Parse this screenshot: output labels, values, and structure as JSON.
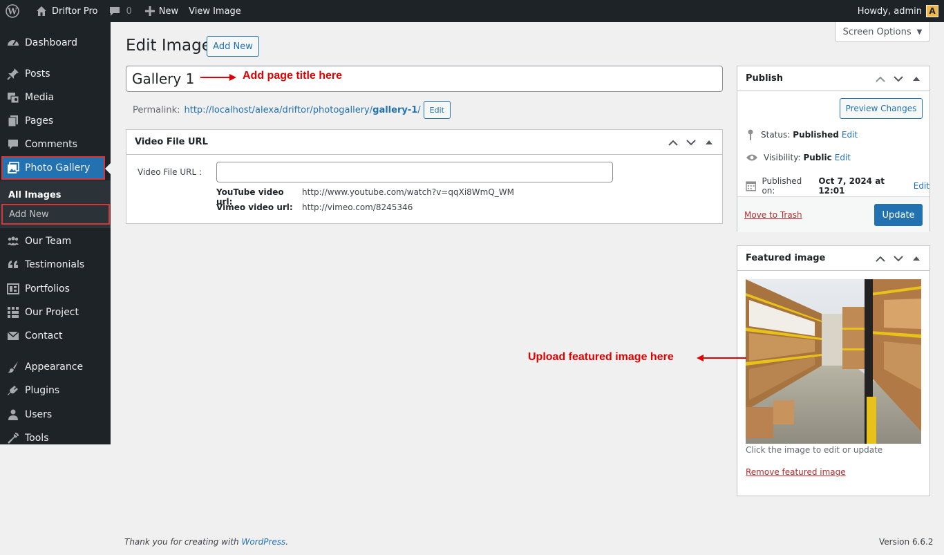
{
  "adminbar": {
    "site_name": "Driftor Pro",
    "comments_count": "0",
    "new_label": "New",
    "view_label": "View Image",
    "howdy": "Howdy, admin",
    "avatar_letter": "A"
  },
  "sidebar": {
    "items": [
      {
        "label": "Dashboard",
        "icon": "dashboard-icon"
      },
      {
        "label": "Posts",
        "icon": "pin-icon"
      },
      {
        "label": "Media",
        "icon": "media-icon"
      },
      {
        "label": "Pages",
        "icon": "pages-icon"
      },
      {
        "label": "Comments",
        "icon": "comment-icon"
      },
      {
        "label": "Photo Gallery",
        "icon": "gallery-icon"
      },
      {
        "label": "Our Team",
        "icon": "groups-icon"
      },
      {
        "label": "Testimonials",
        "icon": "quote-icon"
      },
      {
        "label": "Portfolios",
        "icon": "portfolio-icon"
      },
      {
        "label": "Our Project",
        "icon": "grid-icon"
      },
      {
        "label": "Contact",
        "icon": "email-icon"
      },
      {
        "label": "Appearance",
        "icon": "brush-icon"
      },
      {
        "label": "Plugins",
        "icon": "plugin-icon"
      },
      {
        "label": "Users",
        "icon": "user-icon"
      },
      {
        "label": "Tools",
        "icon": "wrench-icon"
      }
    ],
    "submenu": [
      "All Images",
      "Add New"
    ]
  },
  "header": {
    "title": "Edit Image",
    "add_new": "Add New",
    "screen_options": "Screen Options"
  },
  "editor": {
    "post_title": "Gallery 1",
    "title_annotation": "Add page title here",
    "permalink_label": "Permalink:",
    "permalink_base": "http://localhost/alexa/driftor/photogallery/",
    "permalink_slug": "gallery-1",
    "permalink_tail": "/",
    "permalink_edit": "Edit"
  },
  "video_box": {
    "title": "Video File URL",
    "field_label": "Video File URL :",
    "youtube_label": "YouTube video url:",
    "youtube_value": "http://www.youtube.com/watch?v=qqXi8WmQ_WM",
    "vimeo_label": "Vimeo video url:",
    "vimeo_value": "http://vimeo.com/8245346"
  },
  "publish": {
    "title": "Publish",
    "preview": "Preview Changes",
    "status_label": "Status:",
    "status_value": "Published",
    "visibility_label": "Visibility:",
    "visibility_value": "Public",
    "published_label": "Published on:",
    "published_value": "Oct 7, 2024 at 12:01",
    "edit": "Edit",
    "trash": "Move to Trash",
    "update": "Update"
  },
  "featured": {
    "title": "Featured image",
    "caption": "Click the image to edit or update",
    "remove": "Remove featured image",
    "annotation": "Upload featured image here"
  },
  "footer": {
    "thanks_prefix": "Thank you for creating with ",
    "wp_link": "WordPress",
    "thanks_suffix": ".",
    "version": "Version 6.6.2"
  },
  "colors": {
    "accent": "#2271b1",
    "adminbar": "#1d2327",
    "annotation": "#e00000",
    "danger": "#b32d2e"
  }
}
